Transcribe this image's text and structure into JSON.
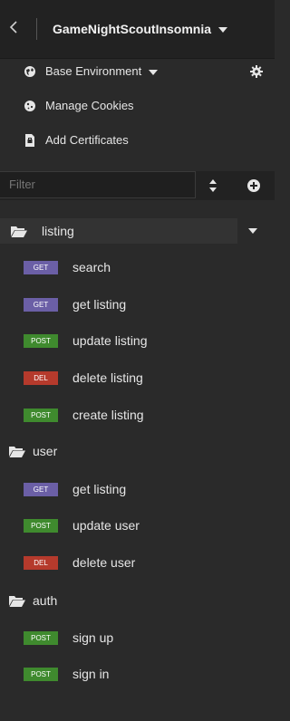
{
  "workspace": {
    "name": "GameNightScoutInsomnia"
  },
  "environment": {
    "label": "Base Environment"
  },
  "menu": {
    "cookies": "Manage Cookies",
    "certificates": "Add Certificates"
  },
  "filter": {
    "placeholder": "Filter"
  },
  "colors": {
    "GET": "#6b5fa6",
    "POST": "#3f8a2e",
    "DEL": "#b53a2c"
  },
  "tree": {
    "listing": {
      "name": "listing",
      "requests": [
        {
          "method": "GET",
          "name": "search"
        },
        {
          "method": "GET",
          "name": "get listing"
        },
        {
          "method": "POST",
          "name": "update listing"
        },
        {
          "method": "DEL",
          "name": "delete listing"
        },
        {
          "method": "POST",
          "name": "create listing"
        }
      ]
    },
    "user": {
      "name": "user",
      "requests": [
        {
          "method": "GET",
          "name": "get listing"
        },
        {
          "method": "POST",
          "name": "update user"
        },
        {
          "method": "DEL",
          "name": "delete user"
        }
      ]
    },
    "auth": {
      "name": "auth",
      "requests": [
        {
          "method": "POST",
          "name": "sign up"
        },
        {
          "method": "POST",
          "name": "sign in"
        }
      ]
    }
  }
}
